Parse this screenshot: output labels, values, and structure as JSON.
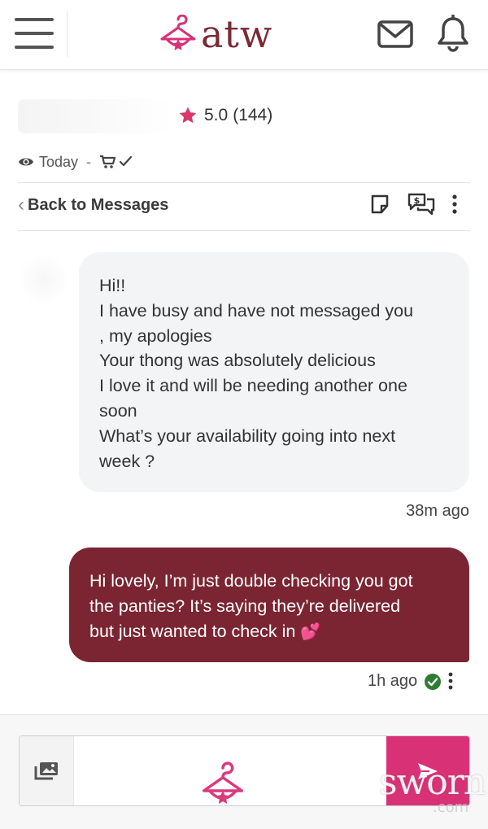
{
  "header": {
    "logo_text": "atw",
    "brand_color": "#7a2a36",
    "accent_color": "#d93176",
    "icons": [
      "menu-icon",
      "hanger-logo-icon",
      "mail-icon",
      "bell-icon"
    ]
  },
  "seller": {
    "rating": "5.0",
    "review_count": "(144)",
    "last_seen": "Today",
    "separator": "-",
    "order_status_icon": "cart-check-icon"
  },
  "nav": {
    "back_label": "Back to Messages",
    "actions": [
      "note-icon",
      "money-chat-icon",
      "more-vertical-icon"
    ]
  },
  "messages": [
    {
      "direction": "incoming",
      "lines": [
        "Hi!!",
        "I have busy and have not messaged you",
        ", my apologies",
        "Your thong was absolutely delicious",
        "I love it and will be needing another one",
        "soon",
        "What’s your availability going into next",
        "week ?"
      ],
      "time": "38m ago"
    },
    {
      "direction": "outgoing",
      "lines": [
        "Hi lovely, I’m just double checking you got",
        "the panties? It’s saying they’re delivered",
        "but just wanted to check in"
      ],
      "emoji": "💕",
      "time": "1h ago",
      "status": "read-check-icon"
    }
  ],
  "composer": {
    "placeholder": "",
    "send_icon": "send-icon",
    "attach_icon": "gallery-icon"
  },
  "watermark": {
    "text": "sworn",
    "sub": ".com"
  }
}
